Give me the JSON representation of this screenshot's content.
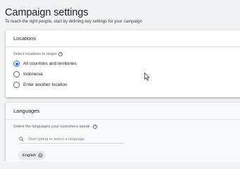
{
  "page": {
    "title": "Campaign settings",
    "subtitle": "To reach the right people, start by defining key settings for your campaign"
  },
  "locations": {
    "header": "Locations",
    "select_label": "Select locations to target",
    "options": [
      {
        "label": "All countries and territories",
        "checked": true
      },
      {
        "label": "Indonesia",
        "checked": false
      },
      {
        "label": "Enter another location",
        "checked": false
      }
    ]
  },
  "languages": {
    "header": "Languages",
    "select_label": "Select the languages your customers speak.",
    "search_placeholder": "Start typing or select a language",
    "selected_chips": [
      "English"
    ]
  },
  "colors": {
    "accent": "#1a73e8",
    "background": "#f1f3f4"
  },
  "icons": [
    "help-icon",
    "search-icon",
    "close-icon",
    "mouse-cursor-icon"
  ]
}
